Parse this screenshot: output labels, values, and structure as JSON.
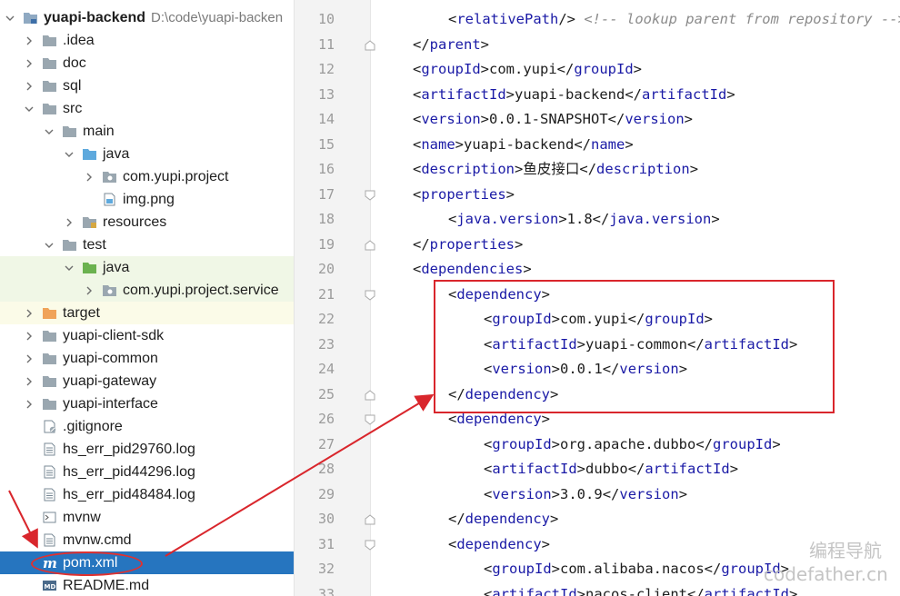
{
  "tree": {
    "root": {
      "name": "yuapi-backend",
      "path": "D:\\code\\yuapi-backen"
    },
    "items": [
      {
        "label": ".idea",
        "icon": "folder-icon"
      },
      {
        "label": "doc",
        "icon": "folder-icon"
      },
      {
        "label": "sql",
        "icon": "folder-icon"
      },
      {
        "label": "src",
        "icon": "folder-icon"
      },
      {
        "label": "main",
        "icon": "folder-icon"
      },
      {
        "label": "java",
        "icon": "source-folder-icon"
      },
      {
        "label": "com.yupi.project",
        "icon": "package-icon"
      },
      {
        "label": "img.png",
        "icon": "image-file-icon"
      },
      {
        "label": "resources",
        "icon": "resources-folder-icon"
      },
      {
        "label": "test",
        "icon": "folder-icon"
      },
      {
        "label": "java",
        "icon": "test-source-folder-icon"
      },
      {
        "label": "com.yupi.project.service",
        "icon": "package-icon"
      },
      {
        "label": "target",
        "icon": "excluded-folder-icon"
      },
      {
        "label": "yuapi-client-sdk",
        "icon": "folder-icon"
      },
      {
        "label": "yuapi-common",
        "icon": "folder-icon"
      },
      {
        "label": "yuapi-gateway",
        "icon": "folder-icon"
      },
      {
        "label": "yuapi-interface",
        "icon": "folder-icon"
      },
      {
        "label": ".gitignore",
        "icon": "gitignore-file-icon"
      },
      {
        "label": "hs_err_pid29760.log",
        "icon": "text-file-icon"
      },
      {
        "label": "hs_err_pid44296.log",
        "icon": "text-file-icon"
      },
      {
        "label": "hs_err_pid48484.log",
        "icon": "text-file-icon"
      },
      {
        "label": "mvnw",
        "icon": "shell-file-icon"
      },
      {
        "label": "mvnw.cmd",
        "icon": "text-file-icon"
      },
      {
        "label": "pom.xml",
        "icon": "maven-file-icon"
      },
      {
        "label": "README.md",
        "icon": "markdown-file-icon"
      }
    ]
  },
  "editor": {
    "lines": [
      {
        "n": "10",
        "indent": 2,
        "segments": [
          [
            "br",
            "<"
          ],
          [
            "tag",
            "relativePath"
          ],
          [
            "br",
            "/> "
          ],
          [
            "cmt",
            "<!-- lookup parent from repository -->"
          ]
        ]
      },
      {
        "n": "11",
        "indent": 1,
        "segments": [
          [
            "br",
            "</"
          ],
          [
            "tag",
            "parent"
          ],
          [
            "br",
            ">"
          ]
        ]
      },
      {
        "n": "12",
        "indent": 1,
        "segments": [
          [
            "br",
            "<"
          ],
          [
            "tag",
            "groupId"
          ],
          [
            "br",
            ">"
          ],
          [
            "txt",
            "com.yupi"
          ],
          [
            "br",
            "</"
          ],
          [
            "tag",
            "groupId"
          ],
          [
            "br",
            ">"
          ]
        ]
      },
      {
        "n": "13",
        "indent": 1,
        "segments": [
          [
            "br",
            "<"
          ],
          [
            "tag",
            "artifactId"
          ],
          [
            "br",
            ">"
          ],
          [
            "txt",
            "yuapi-backend"
          ],
          [
            "br",
            "</"
          ],
          [
            "tag",
            "artifactId"
          ],
          [
            "br",
            ">"
          ]
        ]
      },
      {
        "n": "14",
        "indent": 1,
        "segments": [
          [
            "br",
            "<"
          ],
          [
            "tag",
            "version"
          ],
          [
            "br",
            ">"
          ],
          [
            "txt",
            "0.0.1-SNAPSHOT"
          ],
          [
            "br",
            "</"
          ],
          [
            "tag",
            "version"
          ],
          [
            "br",
            ">"
          ]
        ]
      },
      {
        "n": "15",
        "indent": 1,
        "segments": [
          [
            "br",
            "<"
          ],
          [
            "tag",
            "name"
          ],
          [
            "br",
            ">"
          ],
          [
            "txt",
            "yuapi-backend"
          ],
          [
            "br",
            "</"
          ],
          [
            "tag",
            "name"
          ],
          [
            "br",
            ">"
          ]
        ]
      },
      {
        "n": "16",
        "indent": 1,
        "segments": [
          [
            "br",
            "<"
          ],
          [
            "tag",
            "description"
          ],
          [
            "br",
            ">"
          ],
          [
            "txt",
            "鱼皮接口"
          ],
          [
            "br",
            "</"
          ],
          [
            "tag",
            "description"
          ],
          [
            "br",
            ">"
          ]
        ]
      },
      {
        "n": "17",
        "indent": 1,
        "segments": [
          [
            "br",
            "<"
          ],
          [
            "tag",
            "properties"
          ],
          [
            "br",
            ">"
          ]
        ]
      },
      {
        "n": "18",
        "indent": 2,
        "segments": [
          [
            "br",
            "<"
          ],
          [
            "tag",
            "java.version"
          ],
          [
            "br",
            ">"
          ],
          [
            "txt",
            "1.8"
          ],
          [
            "br",
            "</"
          ],
          [
            "tag",
            "java.version"
          ],
          [
            "br",
            ">"
          ]
        ]
      },
      {
        "n": "19",
        "indent": 1,
        "segments": [
          [
            "br",
            "</"
          ],
          [
            "tag",
            "properties"
          ],
          [
            "br",
            ">"
          ]
        ]
      },
      {
        "n": "20",
        "indent": 1,
        "segments": [
          [
            "br",
            "<"
          ],
          [
            "tag",
            "dependencies"
          ],
          [
            "br",
            ">"
          ]
        ]
      },
      {
        "n": "21",
        "indent": 2,
        "segments": [
          [
            "br",
            "<"
          ],
          [
            "tag",
            "dependency"
          ],
          [
            "br",
            ">"
          ]
        ]
      },
      {
        "n": "22",
        "indent": 3,
        "segments": [
          [
            "br",
            "<"
          ],
          [
            "tag",
            "groupId"
          ],
          [
            "br",
            ">"
          ],
          [
            "txt",
            "com.yupi"
          ],
          [
            "br",
            "</"
          ],
          [
            "tag",
            "groupId"
          ],
          [
            "br",
            ">"
          ]
        ]
      },
      {
        "n": "23",
        "indent": 3,
        "segments": [
          [
            "br",
            "<"
          ],
          [
            "tag",
            "artifactId"
          ],
          [
            "br",
            ">"
          ],
          [
            "txt",
            "yuapi-common"
          ],
          [
            "br",
            "</"
          ],
          [
            "tag",
            "artifactId"
          ],
          [
            "br",
            ">"
          ]
        ]
      },
      {
        "n": "24",
        "indent": 3,
        "segments": [
          [
            "br",
            "<"
          ],
          [
            "tag",
            "version"
          ],
          [
            "br",
            ">"
          ],
          [
            "txt",
            "0.0.1"
          ],
          [
            "br",
            "</"
          ],
          [
            "tag",
            "version"
          ],
          [
            "br",
            ">"
          ]
        ]
      },
      {
        "n": "25",
        "indent": 2,
        "segments": [
          [
            "br",
            "</"
          ],
          [
            "tag",
            "dependency"
          ],
          [
            "br",
            ">"
          ]
        ]
      },
      {
        "n": "26",
        "indent": 2,
        "segments": [
          [
            "br",
            "<"
          ],
          [
            "tag",
            "dependency"
          ],
          [
            "br",
            ">"
          ]
        ]
      },
      {
        "n": "27",
        "indent": 3,
        "segments": [
          [
            "br",
            "<"
          ],
          [
            "tag",
            "groupId"
          ],
          [
            "br",
            ">"
          ],
          [
            "txt",
            "org.apache.dubbo"
          ],
          [
            "br",
            "</"
          ],
          [
            "tag",
            "groupId"
          ],
          [
            "br",
            ">"
          ]
        ]
      },
      {
        "n": "28",
        "indent": 3,
        "segments": [
          [
            "br",
            "<"
          ],
          [
            "tag",
            "artifactId"
          ],
          [
            "br",
            ">"
          ],
          [
            "txt",
            "dubbo"
          ],
          [
            "br",
            "</"
          ],
          [
            "tag",
            "artifactId"
          ],
          [
            "br",
            ">"
          ]
        ]
      },
      {
        "n": "29",
        "indent": 3,
        "segments": [
          [
            "br",
            "<"
          ],
          [
            "tag",
            "version"
          ],
          [
            "br",
            ">"
          ],
          [
            "txt",
            "3.0.9"
          ],
          [
            "br",
            "</"
          ],
          [
            "tag",
            "version"
          ],
          [
            "br",
            ">"
          ]
        ]
      },
      {
        "n": "30",
        "indent": 2,
        "segments": [
          [
            "br",
            "</"
          ],
          [
            "tag",
            "dependency"
          ],
          [
            "br",
            ">"
          ]
        ]
      },
      {
        "n": "31",
        "indent": 2,
        "segments": [
          [
            "br",
            "<"
          ],
          [
            "tag",
            "dependency"
          ],
          [
            "br",
            ">"
          ]
        ]
      },
      {
        "n": "32",
        "indent": 3,
        "segments": [
          [
            "br",
            "<"
          ],
          [
            "tag",
            "groupId"
          ],
          [
            "br",
            ">"
          ],
          [
            "txt",
            "com.alibaba.nacos"
          ],
          [
            "br",
            "</"
          ],
          [
            "tag",
            "groupId"
          ],
          [
            "br",
            ">"
          ]
        ]
      },
      {
        "n": "33",
        "indent": 3,
        "segments": [
          [
            "br",
            "<"
          ],
          [
            "tag",
            "artifactId"
          ],
          [
            "br",
            ">"
          ],
          [
            "txt",
            "nacos-client"
          ],
          [
            "br",
            "</"
          ],
          [
            "tag",
            "artifactId"
          ],
          [
            "br",
            ">"
          ]
        ]
      }
    ]
  },
  "watermark": {
    "line1": "编程导航",
    "line2": "codefather.cn"
  },
  "colors": {
    "selection": "#2675bf",
    "annotation": "#d9262c",
    "xml_tag": "#1a1aa6"
  }
}
